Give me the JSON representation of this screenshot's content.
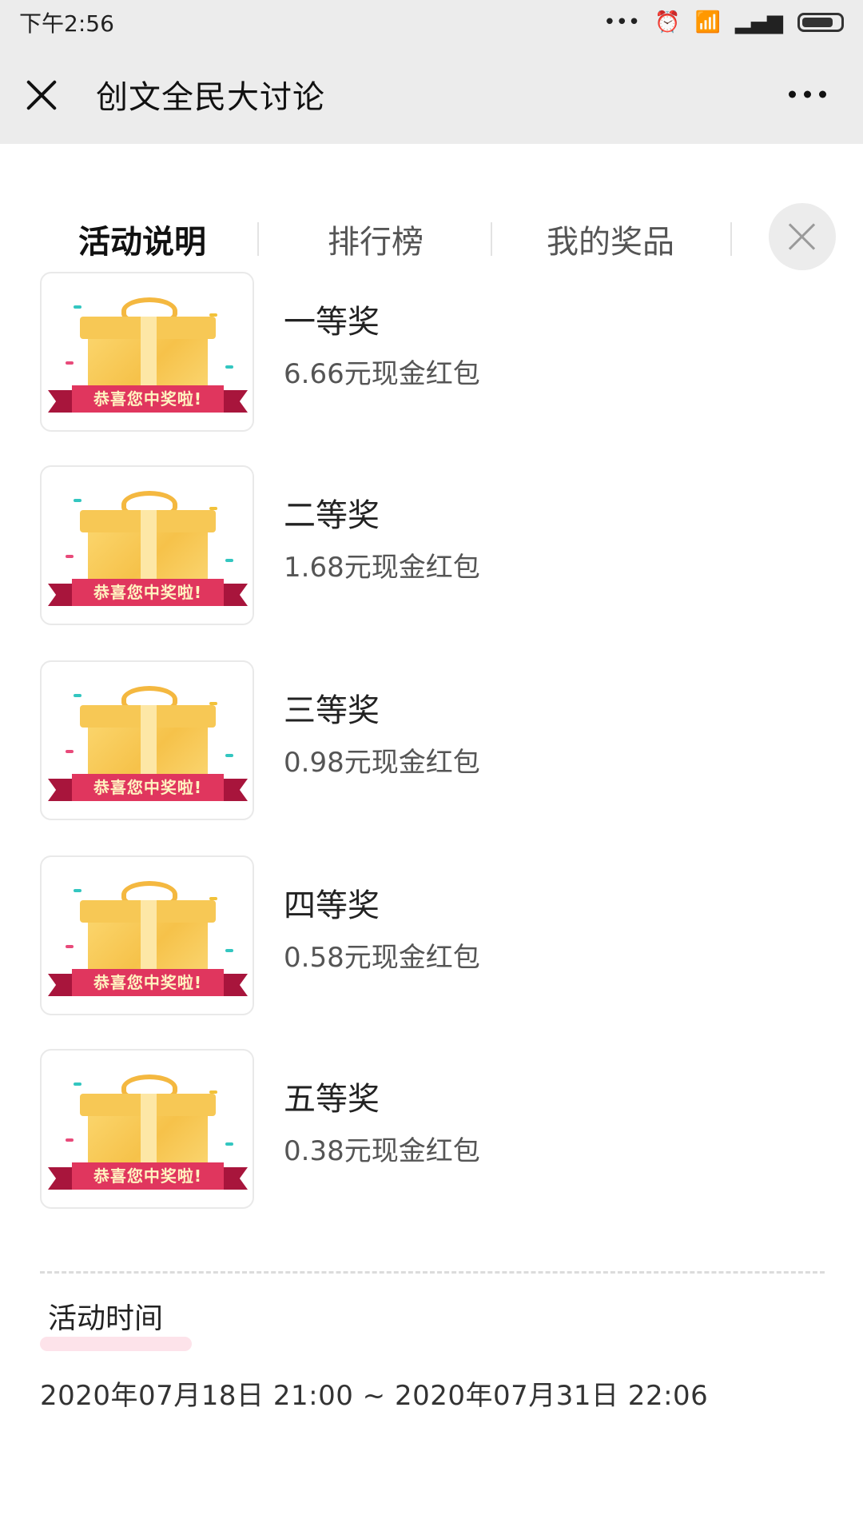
{
  "status_bar": {
    "time": "下午2:56",
    "icons": [
      "more-dots-icon",
      "alarm-icon",
      "wifi-icon",
      "signal-icon",
      "battery-icon"
    ]
  },
  "header": {
    "title": "创文全民大讨论"
  },
  "tabs": [
    {
      "label": "活动说明",
      "active": true
    },
    {
      "label": "排行榜",
      "active": false
    },
    {
      "label": "我的奖品",
      "active": false
    }
  ],
  "prizes": [
    {
      "name": "一等奖",
      "desc": "6.66元现金红包",
      "banner": "恭喜您中奖啦!"
    },
    {
      "name": "二等奖",
      "desc": "1.68元现金红包",
      "banner": "恭喜您中奖啦!"
    },
    {
      "name": "三等奖",
      "desc": "0.98元现金红包",
      "banner": "恭喜您中奖啦!"
    },
    {
      "name": "四等奖",
      "desc": "0.58元现金红包",
      "banner": "恭喜您中奖啦!"
    },
    {
      "name": "五等奖",
      "desc": "0.38元现金红包",
      "banner": "恭喜您中奖啦!"
    }
  ],
  "activity_time": {
    "label": "活动时间",
    "value": "2020年07月18日 21:00 ~ 2020年07月31日 22:06"
  },
  "colors": {
    "accent": "#ef4668",
    "header_bg": "#ececec",
    "banner": "#e0365e"
  }
}
